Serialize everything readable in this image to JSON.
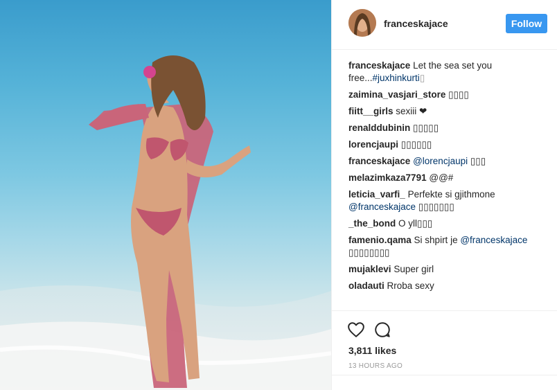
{
  "post": {
    "username": "franceskajace",
    "follow_label": "Follow",
    "caption": {
      "user": "franceskajace",
      "text": "Let the sea set you free...",
      "hashtag": "#juxhinkurti",
      "trail": "▯"
    },
    "comments": [
      {
        "user": "zaimina_vasjari_store",
        "pre": "",
        "mention": "",
        "text": "▯▯▯▯"
      },
      {
        "user": "fiitt__girls",
        "pre": "",
        "mention": "",
        "text": "sexiii ❤"
      },
      {
        "user": "renalddubinin",
        "pre": "",
        "mention": "",
        "text": "▯▯▯▯▯"
      },
      {
        "user": "lorencjaupi",
        "pre": "",
        "mention": "",
        "text": "▯▯▯▯▯▯"
      },
      {
        "user": "franceskajace",
        "pre": "",
        "mention": "@lorencjaupi",
        "text": "▯▯▯"
      },
      {
        "user": "melazimkaza7791",
        "pre": "",
        "mention": "",
        "text": "@@#"
      },
      {
        "user": "leticia_varfi_",
        "pre": "Perfekte si gjithmone",
        "mention": "@franceskajace",
        "text": "▯▯▯▯▯▯▯"
      },
      {
        "user": "_the_bond",
        "pre": "",
        "mention": "",
        "text": "O yll▯▯▯"
      },
      {
        "user": "famenio.qama",
        "pre": "Si shpirt je",
        "mention": "@franceskajace",
        "text": "▯▯▯▯▯▯▯▯"
      },
      {
        "user": "mujaklevi",
        "pre": "",
        "mention": "",
        "text": "Super girl"
      },
      {
        "user": "oladauti",
        "pre": "",
        "mention": "",
        "text": "Rroba sexy"
      }
    ],
    "likes": "3,811 likes",
    "time": "13 HOURS AGO",
    "icons": {
      "like": "heart-icon",
      "comment": "comment-bubble-icon"
    },
    "colors": {
      "accent": "#3897f0",
      "mention": "#003569"
    }
  }
}
